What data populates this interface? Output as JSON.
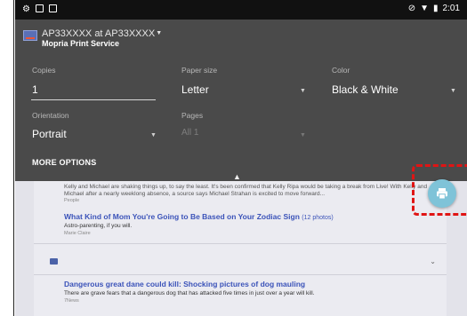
{
  "status_bar": {
    "time": "2:01",
    "left_icons": [
      "notification-icon",
      "message-icon",
      "storage-icon"
    ],
    "right_icons": [
      "sync-icon",
      "wifi-icon",
      "battery-icon"
    ]
  },
  "print_panel": {
    "printer_name": "AP33XXXX at AP33XXXX",
    "printer_service": "Mopria Print Service",
    "copies": {
      "label": "Copies",
      "value": "1"
    },
    "paper_size": {
      "label": "Paper size",
      "value": "Letter"
    },
    "color": {
      "label": "Color",
      "value": "Black & White"
    },
    "orientation": {
      "label": "Orientation",
      "value": "Portrait"
    },
    "pages": {
      "label": "Pages",
      "value": "All 1"
    },
    "more_options_label": "MORE OPTIONS"
  },
  "background_feed": {
    "items": [
      {
        "snippet": "Kelly and Michael are shaking things up, to say the least. It's been confirmed that Kelly Ripa would be taking a break from Live! With Kelly and Michael after a nearly weeklong absence, a source says Michael Strahan is excited to move forward...",
        "source": "People"
      },
      {
        "title": "What Kind of Mom You're Going to Be Based on Your Zodiac Sign",
        "photo_count": "(12 photos)",
        "subtitle": "Astro-parenting, if you will.",
        "source": "Marie Claire"
      },
      {
        "title": "Dangerous great dane could kill: Shocking pictures of dog mauling",
        "subtitle": "There are grave fears that a dangerous dog that has attacked five times in just over a year will kill.",
        "source": "7News"
      }
    ]
  },
  "fab": {
    "icon": "print-icon",
    "color": "#7fc3d8"
  },
  "highlight": {
    "color": "#e01414",
    "style": "dashed"
  }
}
